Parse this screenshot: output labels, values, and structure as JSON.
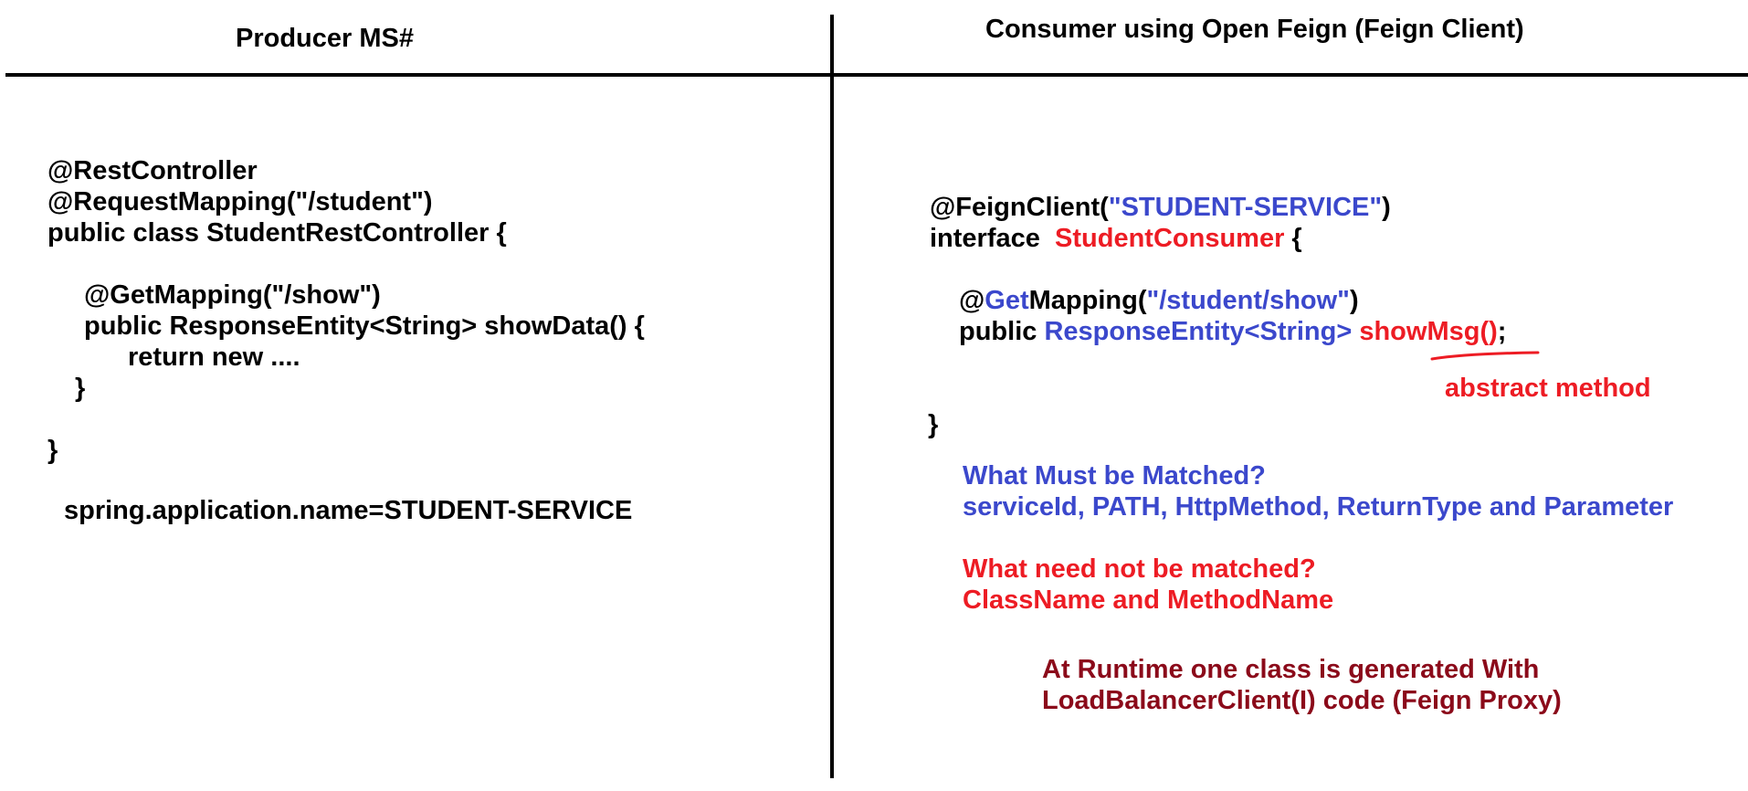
{
  "left_panel": {
    "heading": "Producer MS#",
    "code_lines": [
      "@RestController",
      "@RequestMapping(\"/student\")",
      "public class StudentRestController {",
      "@GetMapping(\"/show\")",
      "public ResponseEntity<String> showData() {",
      "return new ....",
      "}",
      "}"
    ],
    "property": "spring.application.name=STUDENT-SERVICE"
  },
  "right_panel": {
    "heading": "Consumer using Open Feign (Feign Client)",
    "feign_annotation": {
      "prefix": "@FeignClient(",
      "service_id": "\"STUDENT-SERVICE\"",
      "suffix": ")"
    },
    "interface_line": {
      "keyword": "interface ",
      "name": "StudentConsumer",
      "brace": " {"
    },
    "get_mapping_line": {
      "at": "@",
      "get": "Get",
      "mapping": "Mapping(",
      "path": "\"/student/show\"",
      "close": ")"
    },
    "method_line": {
      "modifier": "public ",
      "return_type": "ResponseEntity<String>",
      "method_name": "showMsg()",
      "semicolon": ";"
    },
    "closing_brace": "}",
    "annotation_note": "abstract method",
    "must_match": {
      "question": "What Must be Matched?",
      "answer": "serviceId, PATH, HttpMethod, ReturnType and Parameter"
    },
    "need_not_match": {
      "question": "What need not be matched?",
      "answer": "ClassName and MethodName"
    },
    "runtime_note": [
      "At Runtime one class is generated With",
      "LoadBalancerClient(I) code (Feign Proxy)"
    ]
  },
  "colors": {
    "blue": "#3b48cc",
    "red": "#ed1c24",
    "maroon": "#8b0a1a"
  }
}
